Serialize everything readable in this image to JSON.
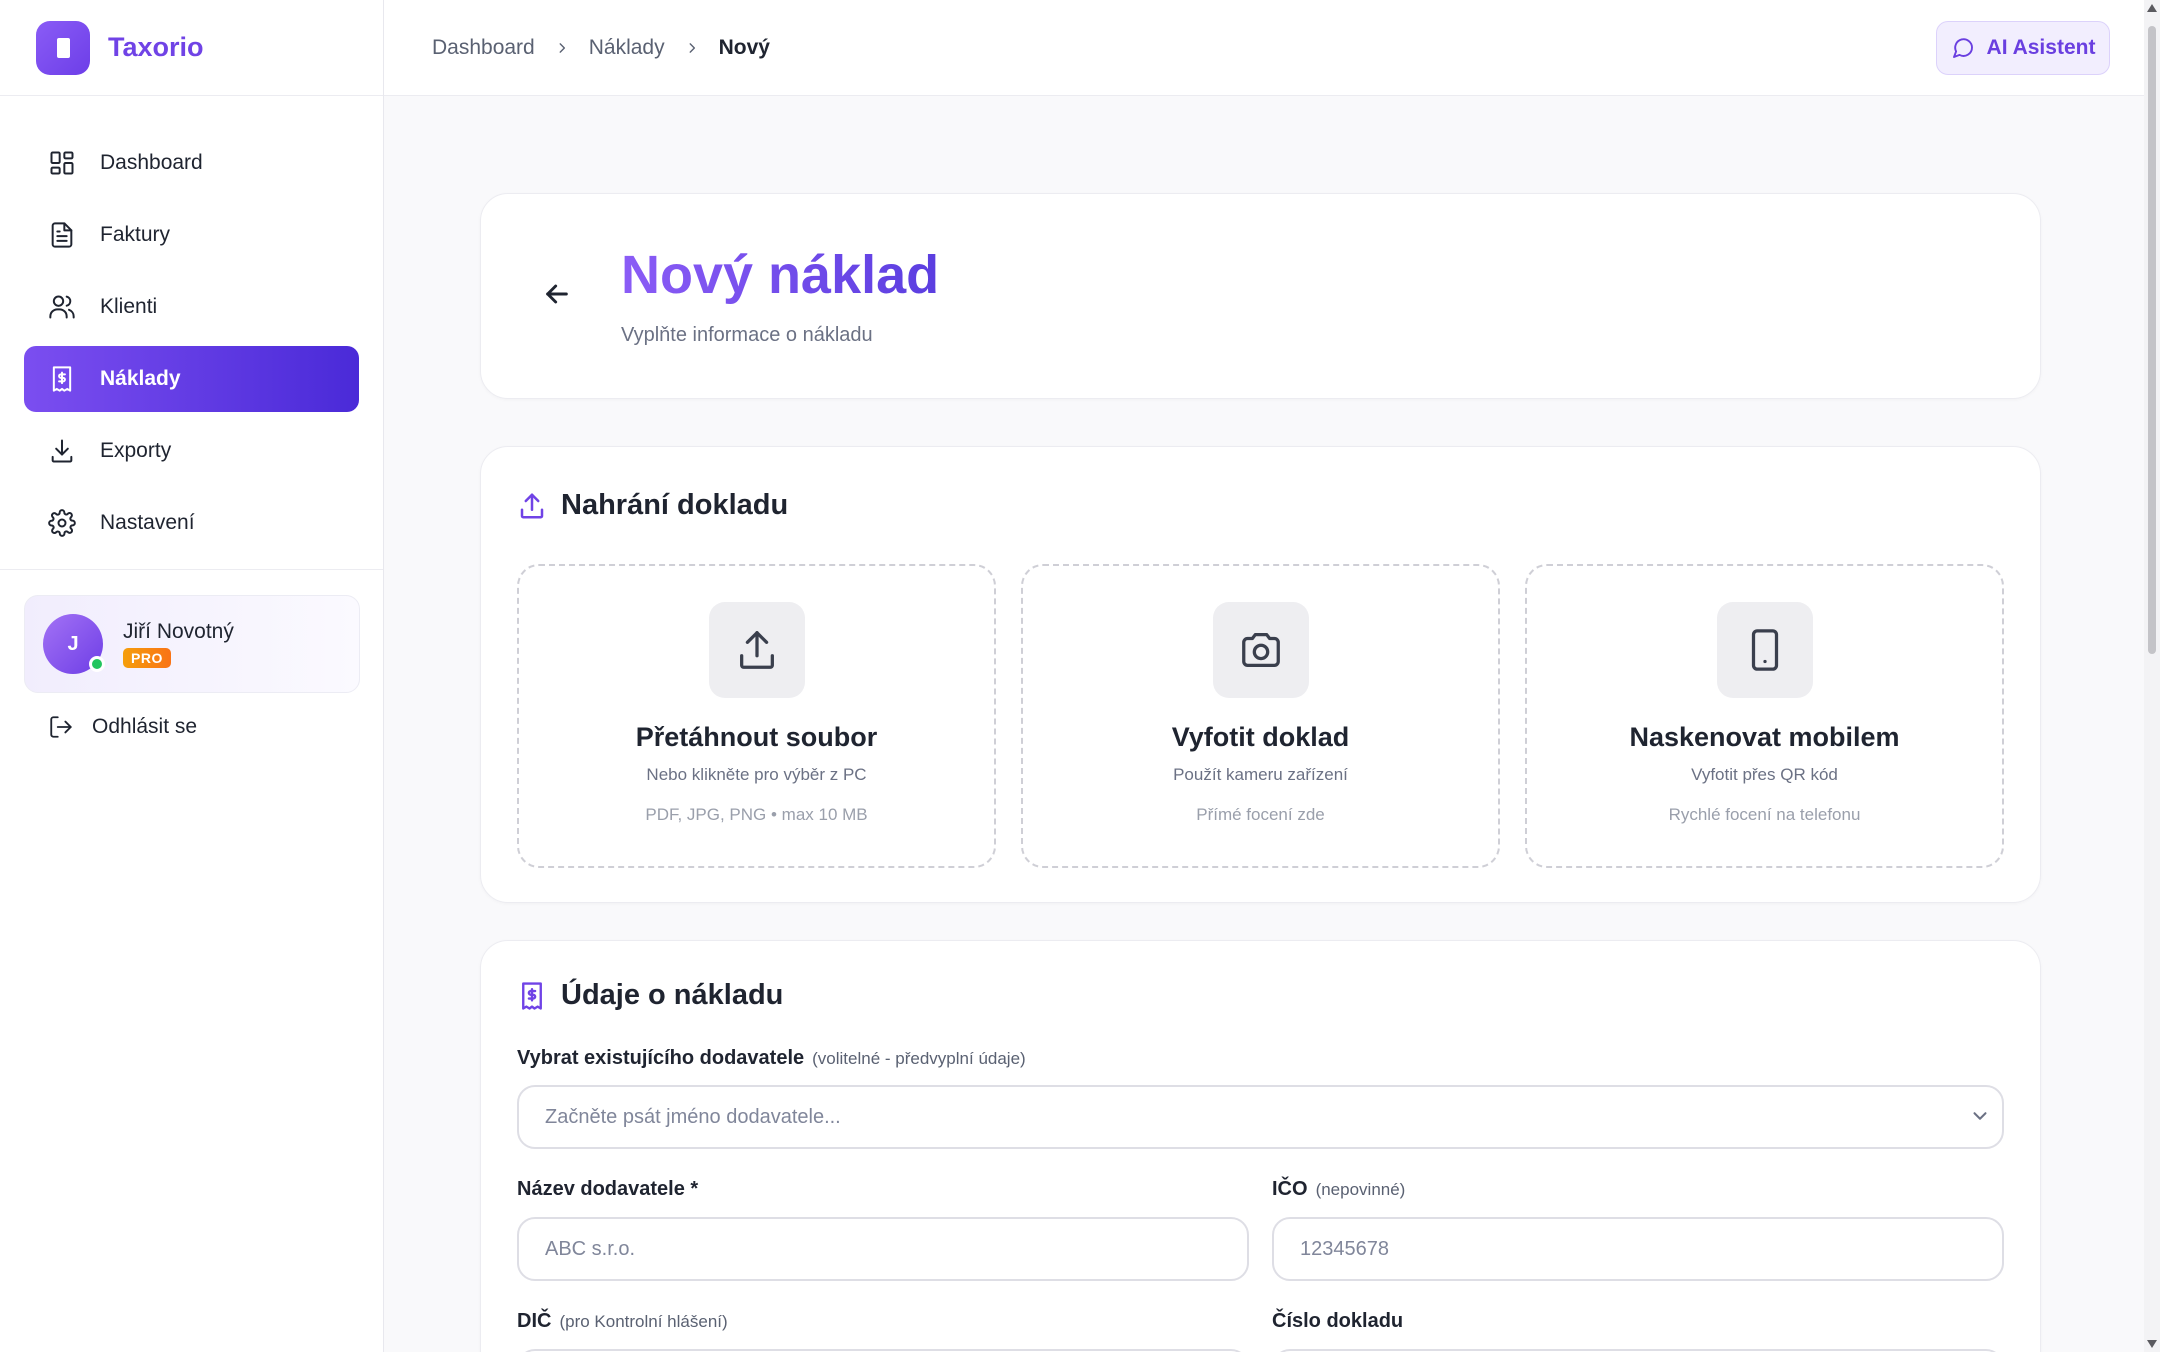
{
  "app": {
    "name": "Taxorio"
  },
  "sidebar": {
    "items": [
      {
        "label": "Dashboard",
        "icon": "dashboard-icon",
        "active": false
      },
      {
        "label": "Faktury",
        "icon": "invoice-icon",
        "active": false
      },
      {
        "label": "Klienti",
        "icon": "users-icon",
        "active": false
      },
      {
        "label": "Náklady",
        "icon": "receipt-icon",
        "active": true
      },
      {
        "label": "Exporty",
        "icon": "download-icon",
        "active": false
      },
      {
        "label": "Nastavení",
        "icon": "gear-icon",
        "active": false
      }
    ],
    "user": {
      "initial": "J",
      "name": "Jiří Novotný",
      "plan": "PRO",
      "status": "online"
    },
    "logout_label": "Odhlásit se"
  },
  "topbar": {
    "breadcrumb": [
      "Dashboard",
      "Náklady",
      "Nový"
    ],
    "ai_button_label": "AI Asistent"
  },
  "header": {
    "title": "Nový náklad",
    "subtitle": "Vyplňte informace o nákladu"
  },
  "upload": {
    "title": "Nahrání dokladu",
    "options": [
      {
        "title": "Přetáhnout soubor",
        "subtitle": "Nebo klikněte pro výběr z PC",
        "note": "PDF, JPG, PNG • max 10 MB",
        "icon": "upload-icon"
      },
      {
        "title": "Vyfotit doklad",
        "subtitle": "Použít kameru zařízení",
        "note": "Přímé focení zde",
        "icon": "camera-icon"
      },
      {
        "title": "Naskenovat mobilem",
        "subtitle": "Vyfotit přes QR kód",
        "note": "Rychlé focení na telefonu",
        "icon": "smartphone-icon"
      }
    ]
  },
  "form": {
    "title": "Údaje o nákladu",
    "supplier_select": {
      "label": "Vybrat existujícího dodavatele",
      "hint": "(volitelné - předvyplní údaje)",
      "placeholder": "Začněte psát jméno dodavatele..."
    },
    "supplier_name": {
      "label": "Název dodavatele *",
      "placeholder": "ABC s.r.o."
    },
    "ico": {
      "label": "IČO",
      "hint": "(nepovinné)",
      "placeholder": "12345678"
    },
    "dic": {
      "label": "DIČ",
      "hint": "(pro Kontrolní hlášení)"
    },
    "document_number": {
      "label": "Číslo dokladu"
    }
  },
  "colors": {
    "accent": "#7043e6",
    "accent_dark": "#4a2ad8",
    "badge_orange": "#f59e0b",
    "online_green": "#22c55e"
  }
}
